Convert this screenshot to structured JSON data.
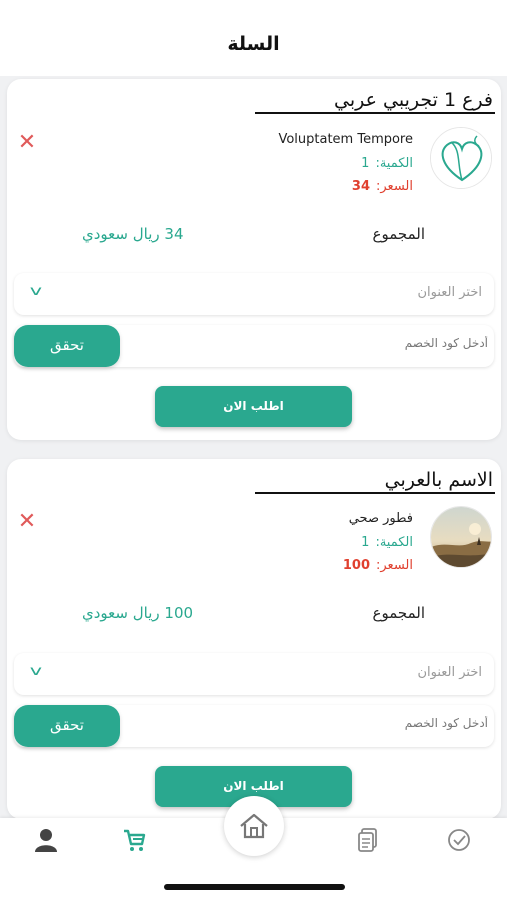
{
  "page": {
    "title": "السلة"
  },
  "status_bar": {
    "left_text": "· · ·",
    "right_text": "· · ·"
  },
  "theme": {
    "accent": "#2aa88f",
    "price_red": "#e0402f",
    "remove_red": "#e05a5a"
  },
  "orders": [
    {
      "branch_title": "فرع 1 تجريبي عربي",
      "item": {
        "name": "Voluptatem Tempore",
        "qty_label": "الكمية:",
        "qty_value": "1",
        "price_label": "السعر:",
        "price_value": "34",
        "image_icon": "heart-logo-icon"
      },
      "total_label": "المجموع",
      "total_value": "34 ريال سعودي",
      "address_placeholder": "اختر العنوان",
      "coupon_placeholder": "أدخل كود الخصم",
      "verify_label": "تحقق",
      "order_label": "اطلب الان"
    },
    {
      "branch_title": "الاسم بالعربي",
      "item": {
        "name": "فطور صحي",
        "qty_label": "الكمية:",
        "qty_value": "1",
        "price_label": "السعر:",
        "price_value": "100",
        "image_icon": "landscape-photo-icon"
      },
      "total_label": "المجموع",
      "total_value": "100 ريال سعودي",
      "address_placeholder": "اختر العنوان",
      "coupon_placeholder": "أدخل كود الخصم",
      "verify_label": "تحقق",
      "order_label": "اطلب الان"
    }
  ],
  "bottom_nav": {
    "items": [
      {
        "icon": "profile-icon"
      },
      {
        "icon": "cart-icon",
        "active": true
      },
      {
        "icon": "home-icon"
      },
      {
        "icon": "orders-list-icon"
      },
      {
        "icon": "check-circle-icon"
      }
    ]
  }
}
